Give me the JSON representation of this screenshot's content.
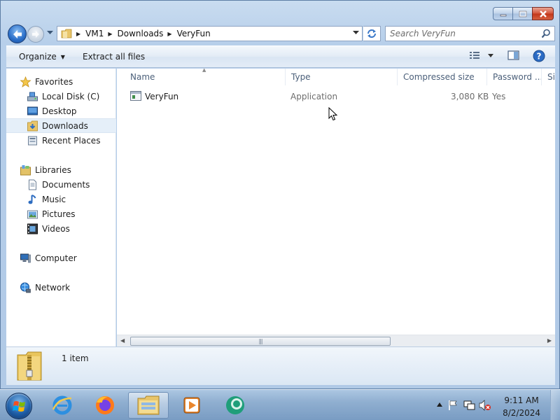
{
  "window": {
    "caption_buttons": [
      "minimize-icon",
      "maximize-icon",
      "close-icon"
    ]
  },
  "navigation": {
    "breadcrumb": [
      "VM1",
      "Downloads",
      "VeryFun"
    ],
    "search_placeholder": "Search VeryFun"
  },
  "commands": {
    "organize": "Organize",
    "extract": "Extract all files"
  },
  "nav_pane": {
    "favorites": {
      "label": "Favorites",
      "items": [
        "Local Disk (C)",
        "Desktop",
        "Downloads",
        "Recent Places"
      ]
    },
    "libraries": {
      "label": "Libraries",
      "items": [
        "Documents",
        "Music",
        "Pictures",
        "Videos"
      ]
    },
    "computer": "Computer",
    "network": "Network",
    "selected": "Downloads"
  },
  "columns": [
    "Name",
    "Type",
    "Compressed size",
    "Password ...",
    "Si"
  ],
  "files": [
    {
      "name": "VeryFun",
      "type": "Application",
      "compressed_size": "3,080 KB",
      "password": "Yes",
      "icon": "application-icon"
    }
  ],
  "details": {
    "item_count": "1 item"
  },
  "taskbar": {
    "apps": [
      "internet-explorer-icon",
      "firefox-icon",
      "windows-explorer-icon",
      "media-player-icon",
      "app-icon"
    ],
    "active_app": "windows-explorer-icon",
    "time": "9:11 AM",
    "date": "8/2/2024"
  }
}
